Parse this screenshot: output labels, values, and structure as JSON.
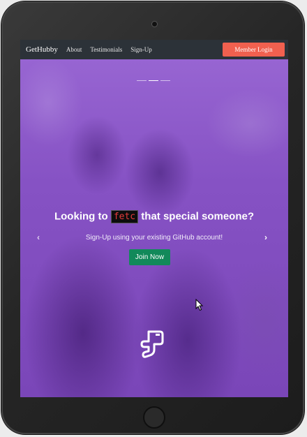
{
  "nav": {
    "brand": "GetHubby",
    "links": [
      "About",
      "Testimonials",
      "Sign-Up"
    ],
    "login_label": "Member Login"
  },
  "hero": {
    "headline_before": "Looking to",
    "headline_code": "fetc",
    "headline_after": "that special someone?",
    "subline": "Sign-Up using your existing GitHub account!",
    "join_label": "Join Now",
    "prev_glyph": "‹",
    "next_glyph": "›",
    "slides": 3,
    "active_slide": 1
  },
  "colors": {
    "navbar": "#2c3238",
    "login_button": "#f0604f",
    "join_button": "#12895a",
    "overlay": "#8a55c8",
    "code_text": "#e63b3b"
  },
  "icons": [
    "fetch-hand-icon",
    "chevron-left-icon",
    "chevron-right-icon",
    "mouse-cursor-icon"
  ]
}
